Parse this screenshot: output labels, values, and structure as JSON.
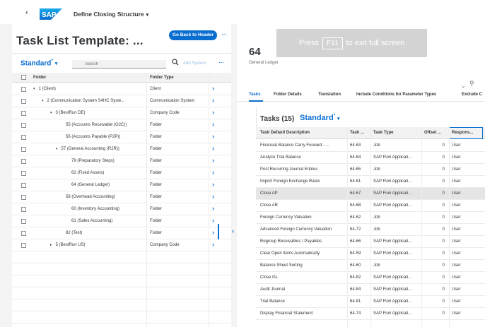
{
  "shell": {
    "back": "‹",
    "logo_text": "SAP",
    "app_title": "Define Closing Structure",
    "app_title_chevron": "▾"
  },
  "left": {
    "title": "Task List Template: ...",
    "go_back_label": "Go Back to Header",
    "more": "···",
    "variant": "Standard",
    "variant_mark": "*",
    "search_placeholder": "Search",
    "add_system_label": "Add System",
    "columns": {
      "folder": "Folder",
      "folder_type": "Folder Type"
    },
    "rows": [
      {
        "toggle": "▾",
        "name": "1 (Client)",
        "type": "Client"
      },
      {
        "toggle": "▾",
        "name": "2 (Communication System S4HC Syste...",
        "type": "Communication System"
      },
      {
        "toggle": "▾",
        "name": "3 (BestRun DE)",
        "type": "Company Code"
      },
      {
        "toggle": "",
        "name": "55 (Accounts Receivable (O2C))",
        "type": "Folder"
      },
      {
        "toggle": "",
        "name": "56 (Accounts Payable (P2P))",
        "type": "Folder"
      },
      {
        "toggle": "▾",
        "name": "57 (General Accounting (R2R))",
        "type": "Folder"
      },
      {
        "toggle": "",
        "name": "79 (Preparatory Steps)",
        "type": "Folder"
      },
      {
        "toggle": "",
        "name": "62 (Fixed Assets)",
        "type": "Folder"
      },
      {
        "toggle": "",
        "name": "64 (General Ledger)",
        "type": "Folder"
      },
      {
        "toggle": "",
        "name": "58 (Overhead Accounting)",
        "type": "Folder"
      },
      {
        "toggle": "",
        "name": "60 (Inventory Accounting)",
        "type": "Folder"
      },
      {
        "toggle": "",
        "name": "61 (Sales Accounting)",
        "type": "Folder"
      },
      {
        "toggle": "",
        "name": "82 (Test)",
        "type": "Folder"
      },
      {
        "toggle": "▸",
        "name": "5 (BestRun US)",
        "type": "Company Code"
      }
    ],
    "nav_arrow": "›"
  },
  "fullscreen": {
    "press": "Press",
    "key": "F11",
    "rest": "to exit full screen"
  },
  "right": {
    "object_title": "64",
    "object_subtitle": "General Ledger",
    "pin_icon": "⌄",
    "people_icon": "⚲",
    "tabs": [
      "Tasks",
      "Folder Details",
      "Translation",
      "Include Conditions for Parameter Types",
      "Exclude C"
    ],
    "tasks_title": "Tasks (15)",
    "tasks_variant": "Standard",
    "tasks_variant_mark": "*",
    "columns": [
      "Task Default Description",
      "Task ...",
      "Task Type",
      "Offset ...",
      "Respons..."
    ],
    "rows": [
      {
        "desc": "Financial Balance Carry Forward - ...",
        "id": "64-63",
        "type": "Job",
        "offset": "0",
        "resp": "User"
      },
      {
        "desc": "Analyze Trial Balance",
        "id": "64-64",
        "type": "SAP Fiori Applicati...",
        "offset": "0",
        "resp": "User"
      },
      {
        "desc": "Post Recurring Journal Entries",
        "id": "64-65",
        "type": "Job",
        "offset": "0",
        "resp": "User"
      },
      {
        "desc": "Import Foreign Exchange Rates",
        "id": "64-61",
        "type": "SAP Fiori Applicati...",
        "offset": "0",
        "resp": "User"
      },
      {
        "desc": "Close AP",
        "id": "64-67",
        "type": "SAP Fiori Applicati...",
        "offset": "0",
        "resp": "User"
      },
      {
        "desc": "Close AR",
        "id": "64-68",
        "type": "SAP Fiori Applicati...",
        "offset": "0",
        "resp": "User"
      },
      {
        "desc": "Foreign Currency Valuation",
        "id": "64-62",
        "type": "Job",
        "offset": "0",
        "resp": "User"
      },
      {
        "desc": "Advanced Foreign Currency Valuation",
        "id": "64-72",
        "type": "Job",
        "offset": "0",
        "resp": "User"
      },
      {
        "desc": "Regroup Receivables / Payables",
        "id": "64-66",
        "type": "SAP Fiori Applicati...",
        "offset": "0",
        "resp": "User"
      },
      {
        "desc": "Clear Open Items Automatically",
        "id": "64-59",
        "type": "SAP Fiori Applicati...",
        "offset": "0",
        "resp": "User"
      },
      {
        "desc": "Balance Sheet Sorting",
        "id": "64-60",
        "type": "Job",
        "offset": "0",
        "resp": "User"
      },
      {
        "desc": "Close GL",
        "id": "64-82",
        "type": "SAP Fiori Applicati...",
        "offset": "0",
        "resp": "User"
      },
      {
        "desc": "Audit Journal",
        "id": "64-84",
        "type": "SAP Fiori Applicati...",
        "offset": "0",
        "resp": "User"
      },
      {
        "desc": "Trial Balance",
        "id": "64-81",
        "type": "SAP Fiori Applicati...",
        "offset": "0",
        "resp": "User"
      },
      {
        "desc": "Display Financial Statement",
        "id": "64-74",
        "type": "SAP Fiori Applicati...",
        "offset": "0",
        "resp": "User"
      }
    ],
    "splitter_arrow": "›"
  },
  "colors": {
    "accent": "#0a6ed1",
    "selected_row": "#e5e5e5"
  }
}
